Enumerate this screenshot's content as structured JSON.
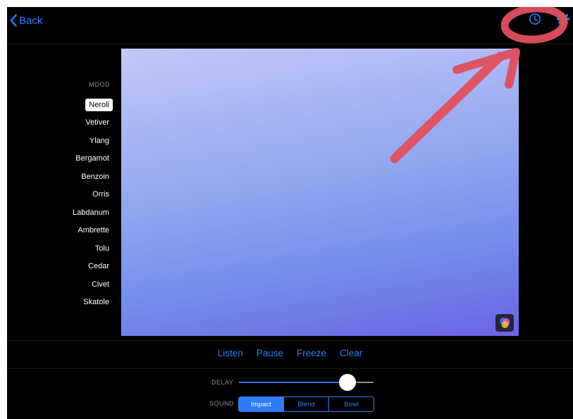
{
  "header": {
    "back_label": "Back",
    "icons": [
      "chevron-left-icon",
      "clock-icon",
      "gear-icon"
    ]
  },
  "mood": {
    "label": "MOOD",
    "selected": "Neroli",
    "items": [
      "Neroli",
      "Vetiver",
      "Ylang",
      "Bergamot",
      "Benzoin",
      "Orris",
      "Labdanum",
      "Ambrette",
      "Tolu",
      "Cedar",
      "Civet",
      "Skatole"
    ]
  },
  "controls": {
    "listen": "Listen",
    "pause": "Pause",
    "freeze": "Freeze",
    "clear": "Clear"
  },
  "delay": {
    "label": "DELAY",
    "value_fraction": 0.82
  },
  "sound": {
    "label": "SOUND",
    "options": [
      "Impact",
      "Blend",
      "Bowl"
    ],
    "selected": "Impact"
  },
  "colors": {
    "accent": "#2f7cf6",
    "annotation": "#e0505e",
    "canvas_top": "#c3c8f9",
    "canvas_bottom": "#6a63e4"
  }
}
